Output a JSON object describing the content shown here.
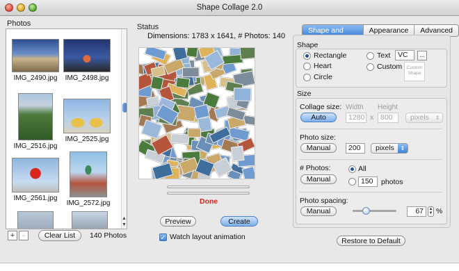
{
  "window": {
    "title": "Shape Collage 2.0"
  },
  "photos": {
    "label": "Photos",
    "items": [
      {
        "name": "IMG_2490.jpg"
      },
      {
        "name": "IMG_2498.jpg"
      },
      {
        "name": "IMG_2516.jpg"
      },
      {
        "name": "IMG_2525.jpg"
      },
      {
        "name": "IMG_2561.jpg"
      },
      {
        "name": "IMG_2572.jpg"
      }
    ],
    "add_label": "+",
    "remove_label": "-",
    "clear_label": "Clear List",
    "count_text": "140 Photos"
  },
  "status": {
    "label": "Status",
    "dimensions_text": "Dimensions: 1783 x 1641, # Photos: 140",
    "done_text": "Done",
    "done_color": "#d9261c",
    "preview_label": "Preview",
    "create_label": "Create",
    "watch_label": "Watch layout animation"
  },
  "tabs": [
    "Shape and Size",
    "Appearance",
    "Advanced"
  ],
  "shape": {
    "title": "Shape",
    "options": {
      "rectangle": "Rectangle",
      "heart": "Heart",
      "circle": "Circle",
      "text": "Text",
      "custom": "Custom"
    },
    "selected": "Rectangle",
    "text_value": "VC",
    "ellipsis_label": "...",
    "custom_shape_label": "Custom Shape"
  },
  "size": {
    "title": "Size",
    "collage_size_label": "Collage size:",
    "collage_mode_label": "Auto",
    "width_label": "Width",
    "height_label": "Height",
    "width_value": "1280",
    "height_value": "800",
    "times": "x",
    "collage_unit": "pixels",
    "photo_size_label": "Photo size:",
    "photo_mode_label": "Manual",
    "photo_size_value": "200",
    "photo_unit": "pixels",
    "num_photos_label": "# Photos:",
    "num_mode_label": "Manual",
    "all_label": "All",
    "num_value": "150",
    "photos_unit": "photos",
    "spacing_label": "Photo spacing:",
    "spacing_mode_label": "Manual",
    "spacing_value": "67",
    "spacing_unit": "%"
  },
  "restore_label": "Restore to Default",
  "colors": {
    "accent": "#3f83d9",
    "done": "#d9261c"
  }
}
